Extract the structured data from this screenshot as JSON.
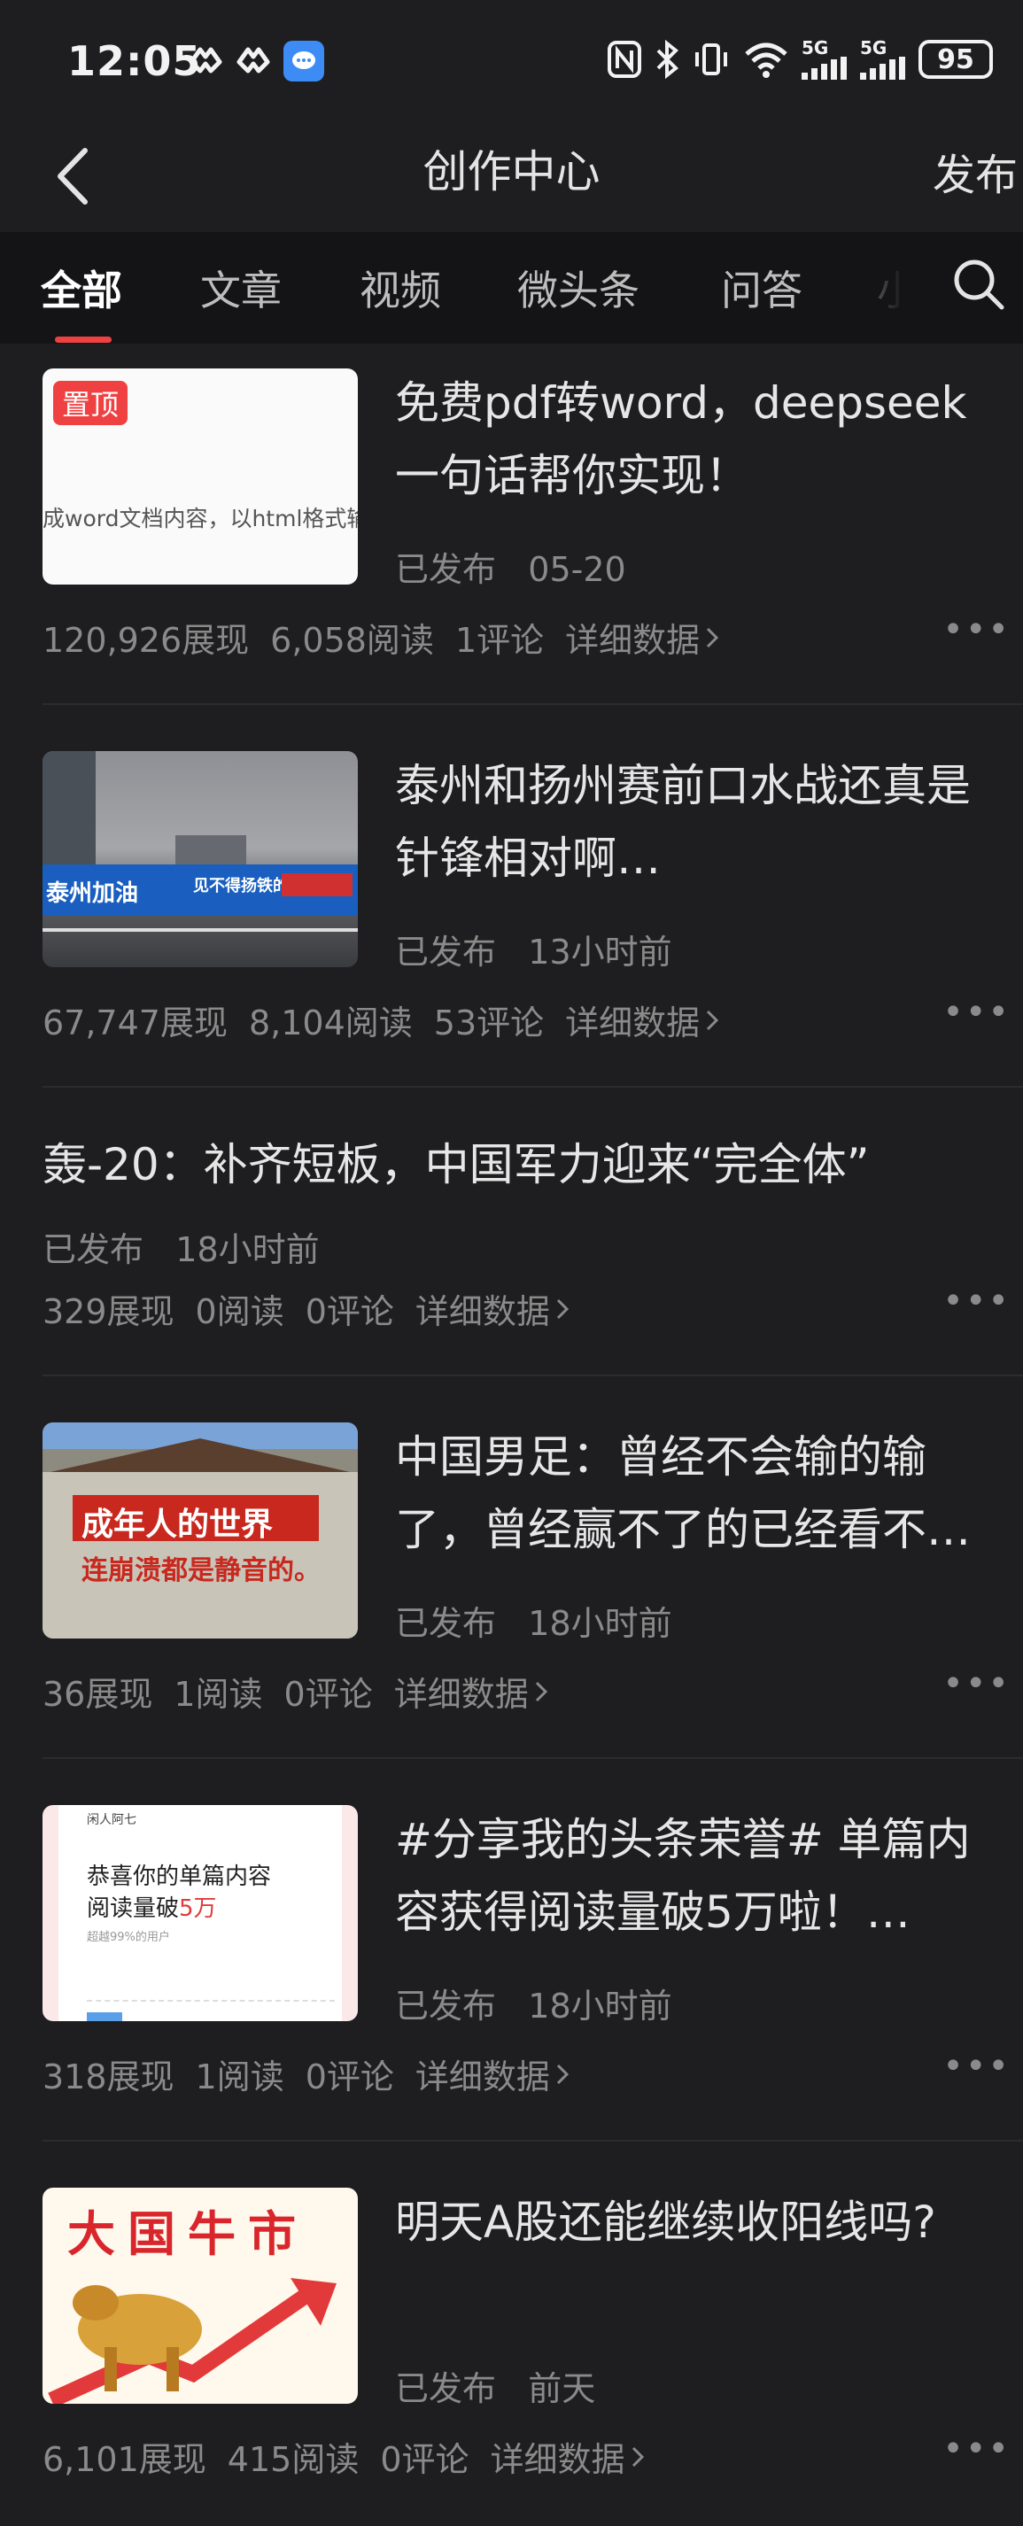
{
  "status_bar": {
    "time": "12:05",
    "network_1": "5G",
    "network_2": "5G",
    "battery": "95"
  },
  "header": {
    "title": "创作中心",
    "publish": "发布"
  },
  "tabs": {
    "items": [
      "全部",
      "文章",
      "视频",
      "微头条",
      "问答",
      "小"
    ],
    "active_index": 0
  },
  "articles": [
    {
      "badge": "置顶",
      "thumb_text": "成word文档内容，以html格式输出。",
      "title": "免费pdf转word，deepseek一句话帮你实现！",
      "status": "已发布",
      "time": "05-20",
      "views": "120,926展现",
      "reads": "6,058阅读",
      "comments": "1评论",
      "detail": "详细数据"
    },
    {
      "thumb_text_1": "泰州加油",
      "thumb_text_2": "见不得扬铁的沙！",
      "title": "泰州和扬州赛前口水战还真是针锋相对啊…",
      "status": "已发布",
      "time": "13小时前",
      "views": "67,747展现",
      "reads": "8,104阅读",
      "comments": "53评论",
      "detail": "详细数据"
    },
    {
      "title": "轰-20：补齐短板，中国军力迎来“完全体”",
      "status": "已发布",
      "time": "18小时前",
      "views": "329展现",
      "reads": "0阅读",
      "comments": "0评论",
      "detail": "详细数据"
    },
    {
      "thumb_text_1": "成年人的世界",
      "thumb_text_2": "连崩溃都是静音的。",
      "title": "中国男足：曾经不会输的输了，曾经赢不了的已经看不…",
      "status": "已发布",
      "time": "18小时前",
      "views": "36展现",
      "reads": "1阅读",
      "comments": "0评论",
      "detail": "详细数据"
    },
    {
      "thumb_text_1": "闲人阿七",
      "thumb_text_2": "恭喜你的单篇内容",
      "thumb_text_3": "阅读量破",
      "thumb_text_4": "5万",
      "thumb_text_5": "超越99%的用户",
      "title": "#分享我的头条荣誉# 单篇内容获得阅读量破5万啦！…",
      "status": "已发布",
      "time": "18小时前",
      "views": "318展现",
      "reads": "1阅读",
      "comments": "0评论",
      "detail": "详细数据"
    },
    {
      "thumb_text_1": "大国牛市",
      "title": "明天A股还能继续收阳线吗?",
      "status": "已发布",
      "time": "前天",
      "views": "6,101展现",
      "reads": "415阅读",
      "comments": "0评论",
      "detail": "详细数据"
    }
  ],
  "colors": {
    "background": "#1e1e20",
    "tab_bar": "#141416",
    "accent": "#f04142",
    "text_primary": "#e6e6e6",
    "text_secondary": "#8a8a8a"
  }
}
